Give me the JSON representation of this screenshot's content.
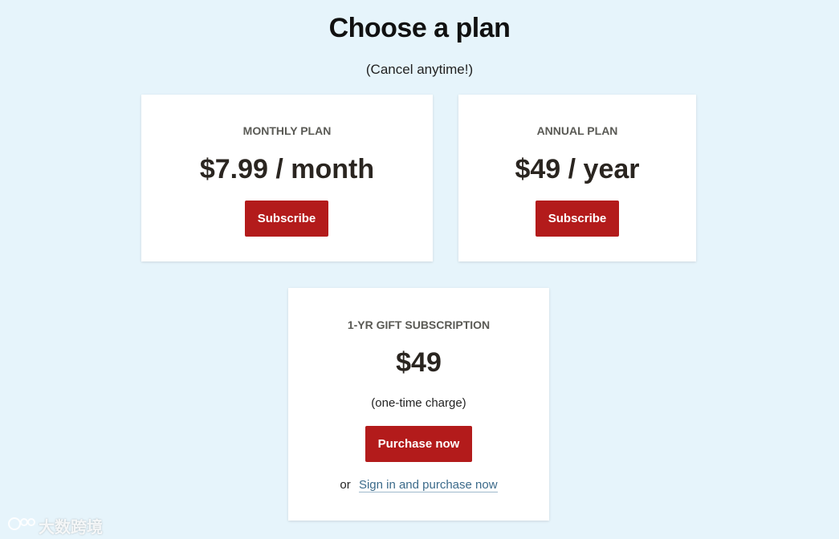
{
  "header": {
    "title": "Choose a plan",
    "subtitle": "(Cancel anytime!)"
  },
  "plans": {
    "monthly": {
      "label": "MONTHLY PLAN",
      "price": "$7.99 / month",
      "button_label": "Subscribe"
    },
    "annual": {
      "label": "ANNUAL PLAN",
      "price": "$49 / year",
      "button_label": "Subscribe"
    },
    "gift": {
      "label": "1-YR GIFT SUBSCRIPTION",
      "price": "$49",
      "note": "(one-time charge)",
      "button_label": "Purchase now",
      "alt_prefix": "or",
      "alt_link": "Sign in and purchase now"
    }
  },
  "watermark": {
    "text": "大数跨境"
  },
  "colors": {
    "background": "#e6f4fb",
    "card": "#ffffff",
    "button": "#b31b1b",
    "link": "#3b6a8a"
  }
}
